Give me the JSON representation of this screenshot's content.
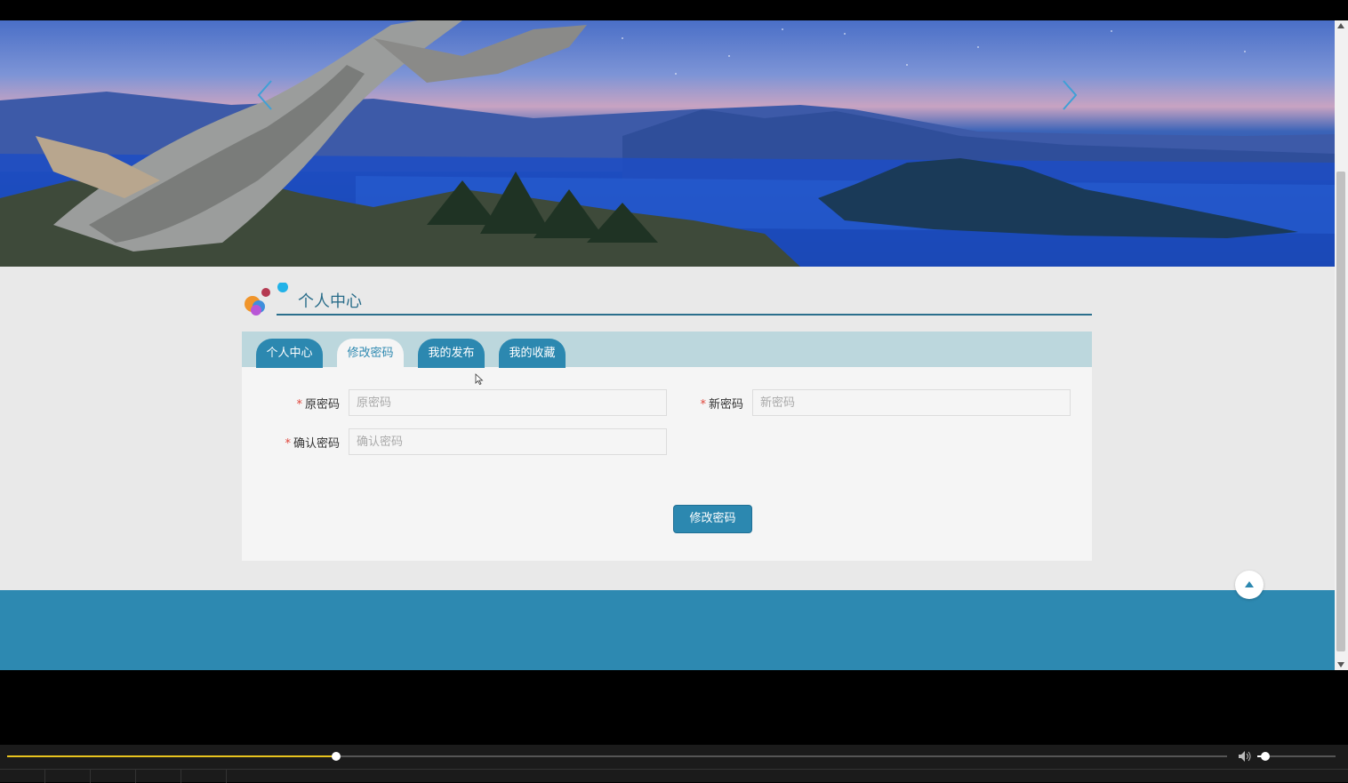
{
  "banner": {
    "prev_label": "‹",
    "next_label": "›"
  },
  "section": {
    "title": "个人中心"
  },
  "tabs": [
    {
      "label": "个人中心"
    },
    {
      "label": "修改密码"
    },
    {
      "label": "我的发布"
    },
    {
      "label": "我的收藏"
    }
  ],
  "form": {
    "required_mark": "*",
    "old_password_label": "原密码",
    "old_password_placeholder": "原密码",
    "new_password_label": "新密码",
    "new_password_placeholder": "新密码",
    "confirm_password_label": "确认密码",
    "confirm_password_placeholder": "确认密码",
    "submit_label": "修改密码"
  },
  "player": {
    "progress": 0.27,
    "volume": 0.1
  },
  "colors": {
    "primary": "#2c88b0",
    "tabbar": "#bcd7dd",
    "footer": "#2d89b1",
    "required": "#e0463c",
    "seek": "#e8c31e"
  }
}
